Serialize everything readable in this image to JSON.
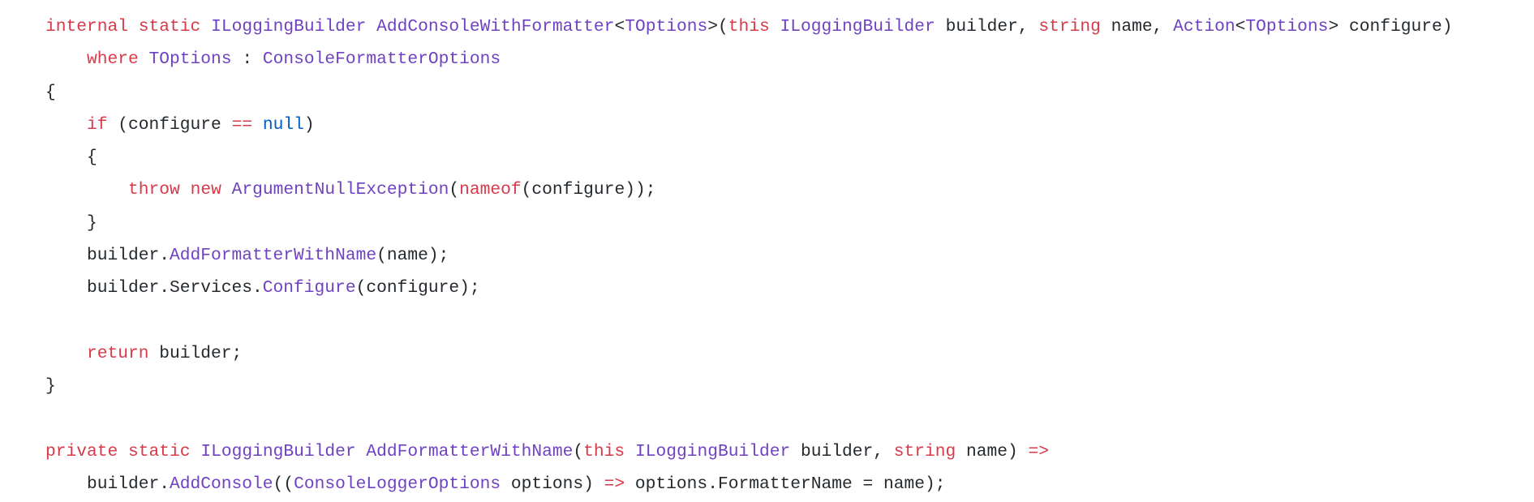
{
  "language": "csharp",
  "colors": {
    "keyword": "#d73a49",
    "type": "#6f42c1",
    "literal": "#005cc5",
    "text": "#24292e",
    "background": "#ffffff"
  },
  "lines": [
    [
      [
        "kw",
        "internal"
      ],
      [
        "pl",
        " "
      ],
      [
        "kw",
        "static"
      ],
      [
        "pl",
        " "
      ],
      [
        "ty",
        "ILoggingBuilder"
      ],
      [
        "pl",
        " "
      ],
      [
        "fn",
        "AddConsoleWithFormatter"
      ],
      [
        "pl",
        "<"
      ],
      [
        "ty",
        "TOptions"
      ],
      [
        "pl",
        ">("
      ],
      [
        "kw",
        "this"
      ],
      [
        "pl",
        " "
      ],
      [
        "ty",
        "ILoggingBuilder"
      ],
      [
        "pl",
        " builder, "
      ],
      [
        "kw",
        "string"
      ],
      [
        "pl",
        " name, "
      ],
      [
        "ty",
        "Action"
      ],
      [
        "pl",
        "<"
      ],
      [
        "ty",
        "TOptions"
      ],
      [
        "pl",
        "> configure)"
      ]
    ],
    [
      [
        "pl",
        "    "
      ],
      [
        "kw",
        "where"
      ],
      [
        "pl",
        " "
      ],
      [
        "ty",
        "TOptions"
      ],
      [
        "pl",
        " : "
      ],
      [
        "ty",
        "ConsoleFormatterOptions"
      ]
    ],
    [
      [
        "pl",
        "{"
      ]
    ],
    [
      [
        "pl",
        "    "
      ],
      [
        "kw",
        "if"
      ],
      [
        "pl",
        " (configure "
      ],
      [
        "op",
        "=="
      ],
      [
        "pl",
        " "
      ],
      [
        "lit",
        "null"
      ],
      [
        "pl",
        ")"
      ]
    ],
    [
      [
        "pl",
        "    {"
      ]
    ],
    [
      [
        "pl",
        "        "
      ],
      [
        "kw",
        "throw"
      ],
      [
        "pl",
        " "
      ],
      [
        "kw",
        "new"
      ],
      [
        "pl",
        " "
      ],
      [
        "ty",
        "ArgumentNullException"
      ],
      [
        "pl",
        "("
      ],
      [
        "kw",
        "nameof"
      ],
      [
        "pl",
        "(configure));"
      ]
    ],
    [
      [
        "pl",
        "    }"
      ]
    ],
    [
      [
        "pl",
        "    builder."
      ],
      [
        "fn",
        "AddFormatterWithName"
      ],
      [
        "pl",
        "(name);"
      ]
    ],
    [
      [
        "pl",
        "    builder.Services."
      ],
      [
        "fn",
        "Configure"
      ],
      [
        "pl",
        "(configure);"
      ]
    ],
    [],
    [
      [
        "pl",
        "    "
      ],
      [
        "kw",
        "return"
      ],
      [
        "pl",
        " builder;"
      ]
    ],
    [
      [
        "pl",
        "}"
      ]
    ],
    [],
    [
      [
        "kw",
        "private"
      ],
      [
        "pl",
        " "
      ],
      [
        "kw",
        "static"
      ],
      [
        "pl",
        " "
      ],
      [
        "ty",
        "ILoggingBuilder"
      ],
      [
        "pl",
        " "
      ],
      [
        "fn",
        "AddFormatterWithName"
      ],
      [
        "pl",
        "("
      ],
      [
        "kw",
        "this"
      ],
      [
        "pl",
        " "
      ],
      [
        "ty",
        "ILoggingBuilder"
      ],
      [
        "pl",
        " builder, "
      ],
      [
        "kw",
        "string"
      ],
      [
        "pl",
        " name) "
      ],
      [
        "op",
        "=>"
      ]
    ],
    [
      [
        "pl",
        "    builder."
      ],
      [
        "fn",
        "AddConsole"
      ],
      [
        "pl",
        "(("
      ],
      [
        "ty",
        "ConsoleLoggerOptions"
      ],
      [
        "pl",
        " options) "
      ],
      [
        "op",
        "=>"
      ],
      [
        "pl",
        " options.FormatterName = name);"
      ]
    ]
  ]
}
